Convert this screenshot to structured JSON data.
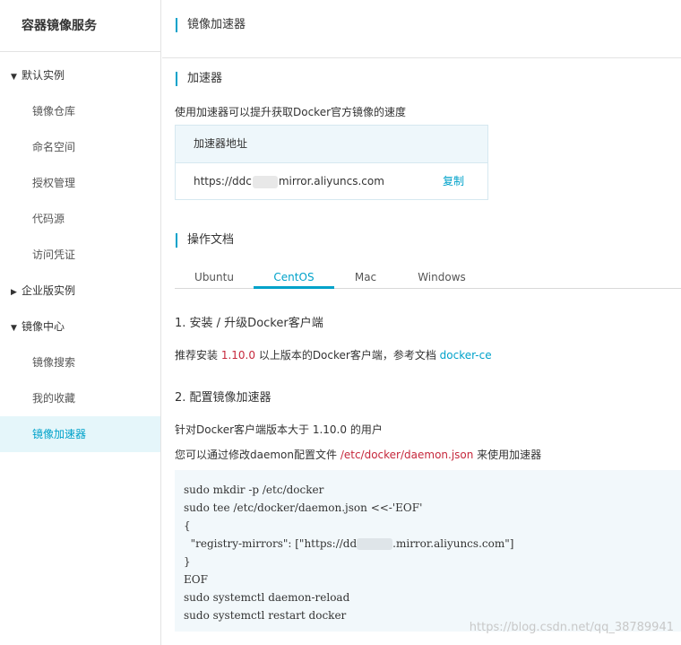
{
  "sidebar": {
    "title": "容器镜像服务",
    "groups": [
      {
        "label": "默认实例",
        "expanded": true,
        "items": [
          "镜像仓库",
          "命名空间",
          "授权管理",
          "代码源",
          "访问凭证"
        ]
      },
      {
        "label": "企业版实例",
        "expanded": false,
        "items": []
      },
      {
        "label": "镜像中心",
        "expanded": true,
        "items": [
          "镜像搜索",
          "我的收藏",
          "镜像加速器"
        ]
      }
    ],
    "active_item": "镜像加速器"
  },
  "header": {
    "title": "镜像加速器"
  },
  "accelerator": {
    "section_title": "加速器",
    "description": "使用加速器可以提升获取Docker官方镜像的速度",
    "table_header": "加速器地址",
    "url_prefix": "https://ddc",
    "url_suffix": "mirror.aliyuncs.com",
    "copy_label": "复制"
  },
  "docs": {
    "section_title": "操作文档",
    "tabs": [
      "Ubuntu",
      "CentOS",
      "Mac",
      "Windows"
    ],
    "active_tab": "CentOS",
    "step1": {
      "title": "1. 安装 / 升级Docker客户端",
      "text_before": "推荐安装 ",
      "version": "1.10.0",
      "text_after": " 以上版本的Docker客户端，参考文档 ",
      "link": "docker-ce"
    },
    "step2": {
      "title": "2. 配置镜像加速器",
      "line1": "针对Docker客户端版本大于 1.10.0 的用户",
      "line2_before": "您可以通过修改daemon配置文件 ",
      "line2_path": "/etc/docker/daemon.json",
      "line2_after": " 来使用加速器"
    },
    "code": {
      "line1": "sudo mkdir -p /etc/docker",
      "line2": "sudo tee /etc/docker/daemon.json <<-'EOF'",
      "line3": "{",
      "line4_prefix": "  \"registry-mirrors\": [\"https://dd",
      "line4_suffix": ".mirror.aliyuncs.com\"]",
      "line5": "}",
      "line6": "EOF",
      "line7": "sudo systemctl daemon-reload",
      "line8": "sudo systemctl restart docker"
    }
  },
  "watermark": "https://blog.csdn.net/qq_38789941",
  "colors": {
    "accent": "#00a2ca",
    "highlight_red": "#c6283c",
    "active_bg": "#e5f6fa",
    "code_bg": "#f2f8fb"
  }
}
